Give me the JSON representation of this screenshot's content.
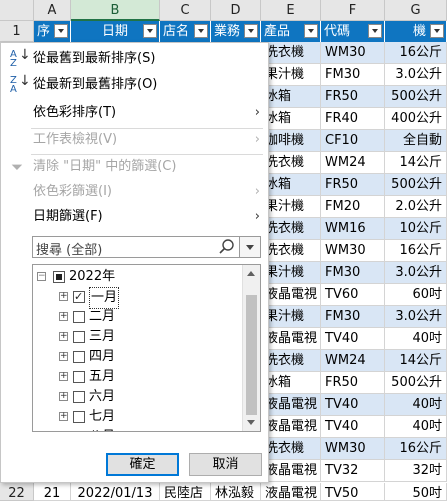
{
  "columns": [
    "A",
    "B",
    "C",
    "D",
    "E",
    "F",
    "G"
  ],
  "rows_numbers": [
    "1",
    "22"
  ],
  "header_row": [
    "序",
    "日期",
    "店名",
    "業務",
    "產品",
    "代碼",
    "機"
  ],
  "table_rows": [
    [
      "洗衣機",
      "WM30",
      "16公斤"
    ],
    [
      "果汁機",
      "FM30",
      "3.0公升"
    ],
    [
      "冰箱",
      "FR50",
      "500公升"
    ],
    [
      "冰箱",
      "FR40",
      "400公升"
    ],
    [
      "咖啡機",
      "CF10",
      "全自動"
    ],
    [
      "洗衣機",
      "WM24",
      "14公斤"
    ],
    [
      "冰箱",
      "FR50",
      "500公升"
    ],
    [
      "果汁機",
      "FM20",
      "2.0公升"
    ],
    [
      "洗衣機",
      "WM16",
      "10公斤"
    ],
    [
      "洗衣機",
      "WM30",
      "16公斤"
    ],
    [
      "果汁機",
      "FM30",
      "3.0公升"
    ],
    [
      "液晶電視",
      "TV60",
      "60吋"
    ],
    [
      "果汁機",
      "FM30",
      "3.0公升"
    ],
    [
      "液晶電視",
      "TV40",
      "40吋"
    ],
    [
      "洗衣機",
      "WM24",
      "14公斤"
    ],
    [
      "冰箱",
      "FR50",
      "500公升"
    ],
    [
      "液晶電視",
      "TV40",
      "40吋"
    ],
    [
      "液晶電視",
      "TV40",
      "40吋"
    ],
    [
      "洗衣機",
      "WM30",
      "16公斤"
    ],
    [
      "液晶電視",
      "TV32",
      "32吋"
    ]
  ],
  "last_row": [
    "21",
    "2022/01/13",
    "民陸店",
    "林泓毅",
    "液晶電視",
    "TV50",
    "50吋"
  ],
  "menu": {
    "sort_asc": "從最舊到最新排序(S)",
    "sort_desc": "從最新到最舊排序(O)",
    "sort_color": "依色彩排序(T)",
    "sheet_view": "工作表檢視(V)",
    "clear_filter": "清除 \"日期\" 中的篩選(C)",
    "filter_color": "依色彩篩選(I)",
    "date_filter": "日期篩選(F)",
    "sort_asc_icon_top": "A",
    "sort_asc_icon_bottom": "Z",
    "sort_desc_icon_top": "Z",
    "sort_desc_icon_bottom": "A"
  },
  "search": {
    "placeholder": "搜尋 (全部)"
  },
  "tree": {
    "year": "2022年",
    "months": [
      "一月",
      "二月",
      "三月",
      "四月",
      "五月",
      "六月",
      "七月",
      "八月"
    ],
    "checked_month": "一月"
  },
  "buttons": {
    "ok": "確定",
    "cancel": "取消"
  },
  "colors": {
    "header_blue": "#0f75c1",
    "band": "#d9e6f5",
    "accent": "#0078d7"
  }
}
